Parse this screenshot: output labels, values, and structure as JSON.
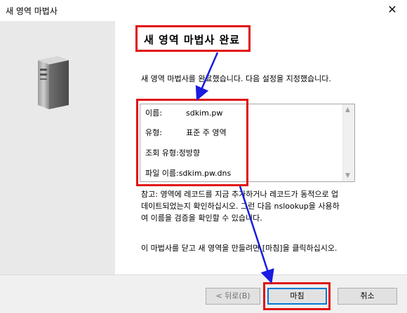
{
  "window": {
    "title": "새 영역 마법사",
    "close_glyph": "✕"
  },
  "heading": "새 영역 마법사 완료",
  "intro": "새 영역 마법사를 완료했습니다. 다음 설정을 지정했습니다.",
  "settings": [
    {
      "key": "이름:",
      "value": "sdkim.pw"
    },
    {
      "key": "유형:",
      "value": "표준 주 영역"
    },
    {
      "key": "조회 유형:",
      "value": "정방향"
    },
    {
      "key": "파일 이름:",
      "value": "sdkim.pw.dns"
    }
  ],
  "note_lines": [
    "참고: 영역에 레코드를 지금 추가하거나 레코드가 동적으로 업",
    "데이트되었는지 확인하십시오. 그런 다음 nslookup을 사용하",
    "여 이름을 검증을 확인할 수 있습니다."
  ],
  "close_instruction": "이 마법사를 닫고 새 영역을 만들려면 [마침]을 클릭하십시오.",
  "buttons": {
    "back": "< 뒤로(B)",
    "finish": "마침",
    "cancel": "취소"
  },
  "colors": {
    "annotation_red": "#e01010",
    "annotation_arrow_blue": "#1a1ae0",
    "left_panel": "#e9e9e9"
  }
}
